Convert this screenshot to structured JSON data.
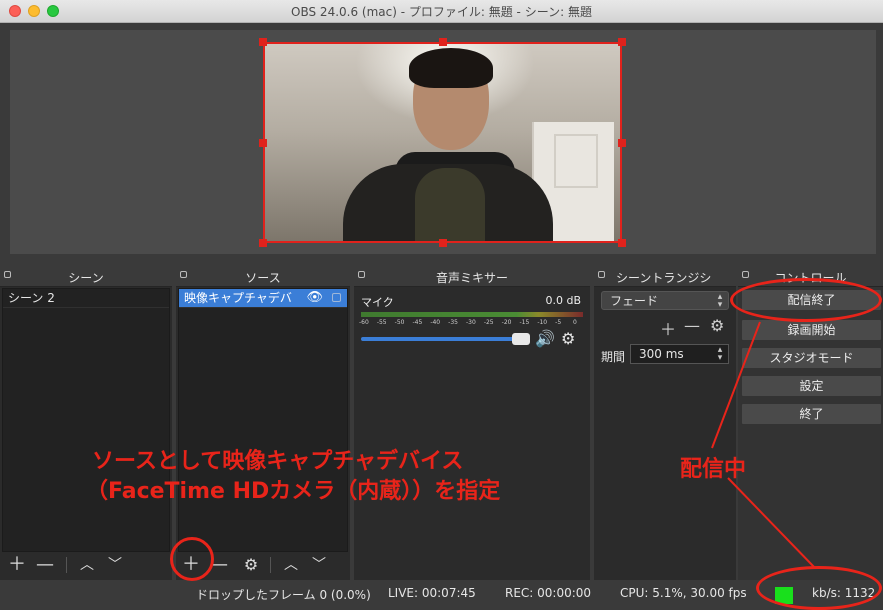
{
  "window": {
    "title": "OBS 24.0.6 (mac) - プロファイル: 無題 - シーン: 無題"
  },
  "docks": {
    "scenes": {
      "title": "シーン",
      "items": [
        "シーン 2"
      ]
    },
    "sources": {
      "title": "ソース",
      "items": [
        "映像キャプチャデバ"
      ]
    },
    "mixer": {
      "title": "音声ミキサー",
      "channel": "マイク",
      "level": "0.0 dB",
      "ticks": [
        "-60",
        "-55",
        "-50",
        "-45",
        "-40",
        "-35",
        "-30",
        "-25",
        "-20",
        "-15",
        "-10",
        "-5",
        "0"
      ],
      "volume_fraction": 1.0
    },
    "transitions": {
      "title": "シーントランジシ",
      "selected": "フェード",
      "duration_label": "期間",
      "duration_value": "300 ms"
    },
    "controls": {
      "title": "コントロール",
      "buttons": [
        "配信終了",
        "録画開始",
        "スタジオモード",
        "設定",
        "終了"
      ]
    }
  },
  "toolbar_icons": {
    "add": "＋",
    "remove": "—",
    "up": "︿",
    "down": "﹀",
    "gear": "⚙"
  },
  "status": {
    "dropped": "ドロップしたフレーム 0 (0.0%)",
    "live": "LIVE: 00:07:45",
    "rec": "REC: 00:00:00",
    "cpu": "CPU: 5.1%, 30.00 fps",
    "kbps": "kb/s: 1132"
  },
  "annotations": {
    "source_note_line1": "ソースとして映像キャプチャデバイス",
    "source_note_line2": "（FaceTime HDカメラ（内蔵））を指定",
    "streaming_note": "配信中"
  },
  "colors": {
    "accent": "#3b7ed7",
    "annotation": "#e8241a",
    "live_indicator": "#19e01c"
  }
}
